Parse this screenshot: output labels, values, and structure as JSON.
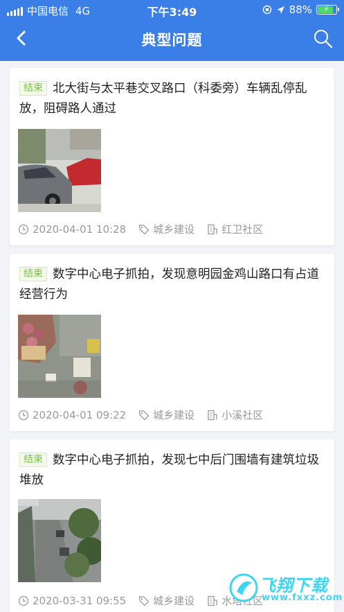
{
  "status_bar": {
    "carrier": "中国电信",
    "network": "4G",
    "time": "下午3:49",
    "battery": "88%",
    "battery_level": 0.88
  },
  "nav": {
    "title": "典型问题",
    "back_icon": "back-arrow-icon",
    "search_icon": "search-icon"
  },
  "colors": {
    "header": "#3a7ee8",
    "tag_text": "#7ac04a",
    "meta_text": "#999999"
  },
  "issues": [
    {
      "status": "结束",
      "title": "北大街与太平巷交叉路口（科委旁）车辆乱停乱放，阻碍路人通过",
      "time": "2020-04-01 10:28",
      "category": "城乡建设",
      "community": "红卫社区"
    },
    {
      "status": "结束",
      "title": "数字中心电子抓拍，发现意明园金鸡山路口有占道经营行为",
      "time": "2020-04-01 09:22",
      "category": "城乡建设",
      "community": "小溪社区"
    },
    {
      "status": "结束",
      "title": "数字中心电子抓拍，发现七中后门围墙有建筑垃圾堆放",
      "time": "2020-03-31 09:55",
      "category": "城乡建设",
      "community": "水塔社区"
    }
  ],
  "watermark": {
    "name": "飞翔下载",
    "url": "www.fxxz.com"
  }
}
